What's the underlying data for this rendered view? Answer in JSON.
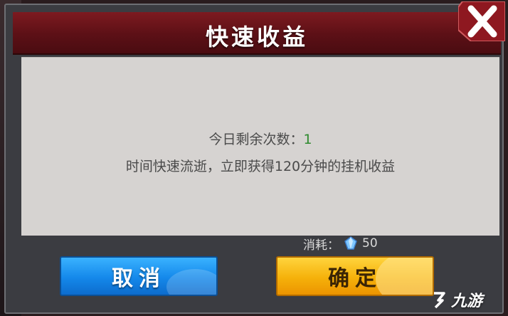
{
  "dialog": {
    "title": "快速收益",
    "remaining_label": "今日剩余次数：",
    "remaining_count": "1",
    "description": "时间快速流逝，立即获得120分钟的挂机收益",
    "cost_label": "消耗：",
    "cost_value": "50",
    "cancel_label": "取消",
    "confirm_label": "确定"
  },
  "watermark": {
    "text": "九游"
  },
  "colors": {
    "header": "#6a141a",
    "panel": "#d6d3d1",
    "count": "#2e8a2e",
    "cancel_button": "#1a8ef0",
    "confirm_button": "#f7b20c"
  },
  "icons": {
    "close": "close-x-icon",
    "currency": "gem-icon",
    "watermark": "j9-logo-icon"
  }
}
